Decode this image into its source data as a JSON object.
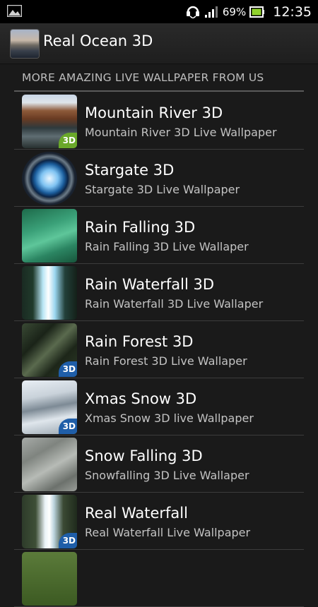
{
  "status_bar": {
    "battery_percent": "69%",
    "time": "12:35",
    "icons": [
      "gallery-icon",
      "headset-icon",
      "signal-icon",
      "battery-icon"
    ]
  },
  "action_bar": {
    "title": "Real Ocean 3D",
    "icon": "app-icon"
  },
  "section": {
    "header": "MORE AMAZING LIVE WALLPAPER FROM US"
  },
  "items": [
    {
      "title": "Mountain River 3D",
      "subtitle": "Mountain River 3D Live Wallpaper",
      "badge": "3D"
    },
    {
      "title": "Stargate 3D",
      "subtitle": "Stargate 3D Live Wallpaper",
      "badge": ""
    },
    {
      "title": "Rain Falling 3D",
      "subtitle": "Rain Falling 3D Live Wallaper",
      "badge": ""
    },
    {
      "title": "Rain Waterfall 3D",
      "subtitle": "Rain Waterfall 3D Live Wallaper",
      "badge": ""
    },
    {
      "title": "Rain Forest 3D",
      "subtitle": "Rain Forest 3D Live Wallaper",
      "badge": "3D"
    },
    {
      "title": "Xmas Snow 3D",
      "subtitle": "Xmas Snow 3D live Wallpaper",
      "badge": "3D"
    },
    {
      "title": "Snow Falling 3D",
      "subtitle": "Snowfalling 3D Live Wallaper",
      "badge": ""
    },
    {
      "title": "Real Waterfall",
      "subtitle": "Real Waterfall Live Wallpaper",
      "badge": "3D"
    }
  ]
}
